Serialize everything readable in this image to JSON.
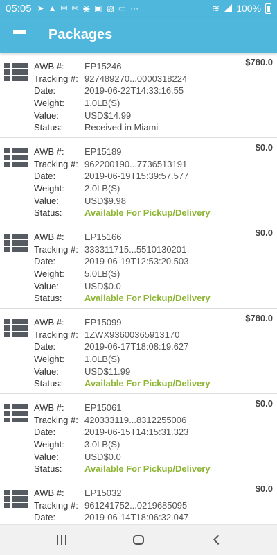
{
  "status_bar": {
    "time": "05:05",
    "battery": "100%",
    "notification_icons": [
      "telegram-icon",
      "alert-icon",
      "gmail-icon",
      "gmail-icon",
      "camera-icon",
      "facebook-icon",
      "image-icon",
      "laptop-icon",
      "more-icon"
    ]
  },
  "app_bar": {
    "title": "Packages"
  },
  "labels": {
    "awb": "AWB #:",
    "tracking": "Tracking #:",
    "date": "Date:",
    "weight": "Weight:",
    "value": "Value:",
    "status": "Status:"
  },
  "colors": {
    "primary": "#4fb6dc",
    "status_available": "#8db533",
    "status_received": "#444444"
  },
  "packages": [
    {
      "amount": "$780.0",
      "awb": "EP15246",
      "tracking": "927489270...0000318224",
      "date": "2019-06-22T14:33:16.55",
      "weight": "1.0LB(S)",
      "value": "USD$14.99",
      "status": "Received in Miami"
    },
    {
      "amount": "$0.0",
      "awb": "EP15189",
      "tracking": "962200190...7736513191",
      "date": "2019-06-19T15:39:57.577",
      "weight": "2.0LB(S)",
      "value": "USD$9.98",
      "status": "Available For Pickup/Delivery"
    },
    {
      "amount": "$0.0",
      "awb": "EP15166",
      "tracking": "333311715...5510130201",
      "date": "2019-06-19T12:53:20.503",
      "weight": "5.0LB(S)",
      "value": "USD$0.0",
      "status": "Available For Pickup/Delivery"
    },
    {
      "amount": "$780.0",
      "awb": "EP15099",
      "tracking": "1ZWX93600365913170",
      "date": "2019-06-17T18:08:19.627",
      "weight": "1.0LB(S)",
      "value": "USD$11.99",
      "status": "Available For Pickup/Delivery"
    },
    {
      "amount": "$0.0",
      "awb": "EP15061",
      "tracking": "420333119...8312255006",
      "date": "2019-06-15T14:15:31.323",
      "weight": "3.0LB(S)",
      "value": "USD$0.0",
      "status": "Available For Pickup/Delivery"
    },
    {
      "amount": "$0.0",
      "awb": "EP15032",
      "tracking": "961241752...0219685095",
      "date": "2019-06-14T18:06:32.047",
      "weight": "",
      "value": "",
      "status": ""
    }
  ]
}
